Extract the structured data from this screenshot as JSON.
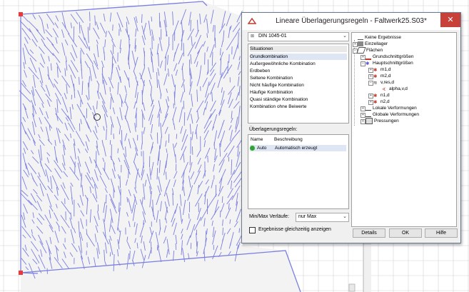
{
  "window": {
    "title": "Lineare Überlagerungsregeln - Faltwerk25.S03*",
    "close_symbol": "✕"
  },
  "norm_select": {
    "value": "DIN 1045-01"
  },
  "situations": {
    "header": "Situationen",
    "items": [
      "Grundkombination",
      "Außergewöhnliche Kombination",
      "Erdbeben",
      "Seltene Kombination",
      "Nicht häufige Kombination",
      "Häufige Kombination",
      "Quasi ständige Kombination",
      "Kombination ohne Beiwerte"
    ]
  },
  "rules": {
    "label": "Überlagerungsregeln:",
    "col_name": "Name",
    "col_desc": "Beschreibung",
    "rows": [
      {
        "name": "Auto",
        "desc": "Automatisch erzeugt"
      }
    ]
  },
  "minmax": {
    "label": "Min/Max Verläufe:",
    "value": "nur Max"
  },
  "simultaneous": {
    "label": "Ergebnisse gleichzeitig anzeigen",
    "checked": false
  },
  "tree": [
    {
      "label": "Keine Ergebnisse",
      "icon": "no-results-icon"
    },
    {
      "label": "Einzellager",
      "icon": "support-icon"
    },
    {
      "label": "Flächen",
      "icon": "surface-icon"
    },
    {
      "label": "Grundschnittgrößen",
      "icon": "basic-forces-icon"
    },
    {
      "label": "Hauptschnittgrößen",
      "icon": "principal-forces-icon"
    },
    {
      "label": "m1,d",
      "icon": "result-icon"
    },
    {
      "label": "m2,d",
      "icon": "result-icon"
    },
    {
      "label": "v,res,d",
      "icon": "result-icon"
    },
    {
      "label": "alpha,v,d",
      "icon": "angle-icon"
    },
    {
      "label": "n1,d",
      "icon": "result-icon"
    },
    {
      "label": "n2,d",
      "icon": "result-icon"
    },
    {
      "label": "Lokale Verformungen",
      "icon": "local-deform-icon"
    },
    {
      "label": "Globale Verformungen",
      "icon": "global-deform-icon"
    },
    {
      "label": "Pressungen",
      "icon": "pressure-icon"
    }
  ],
  "buttons": {
    "details": "Details",
    "ok": "OK",
    "help": "Hilfe"
  },
  "colors": {
    "lines": "#7b7fe0",
    "grid": "#d3d3d3",
    "node": "#e83a3a",
    "close": "#c7403a",
    "accent_green": "#2ea52e"
  }
}
